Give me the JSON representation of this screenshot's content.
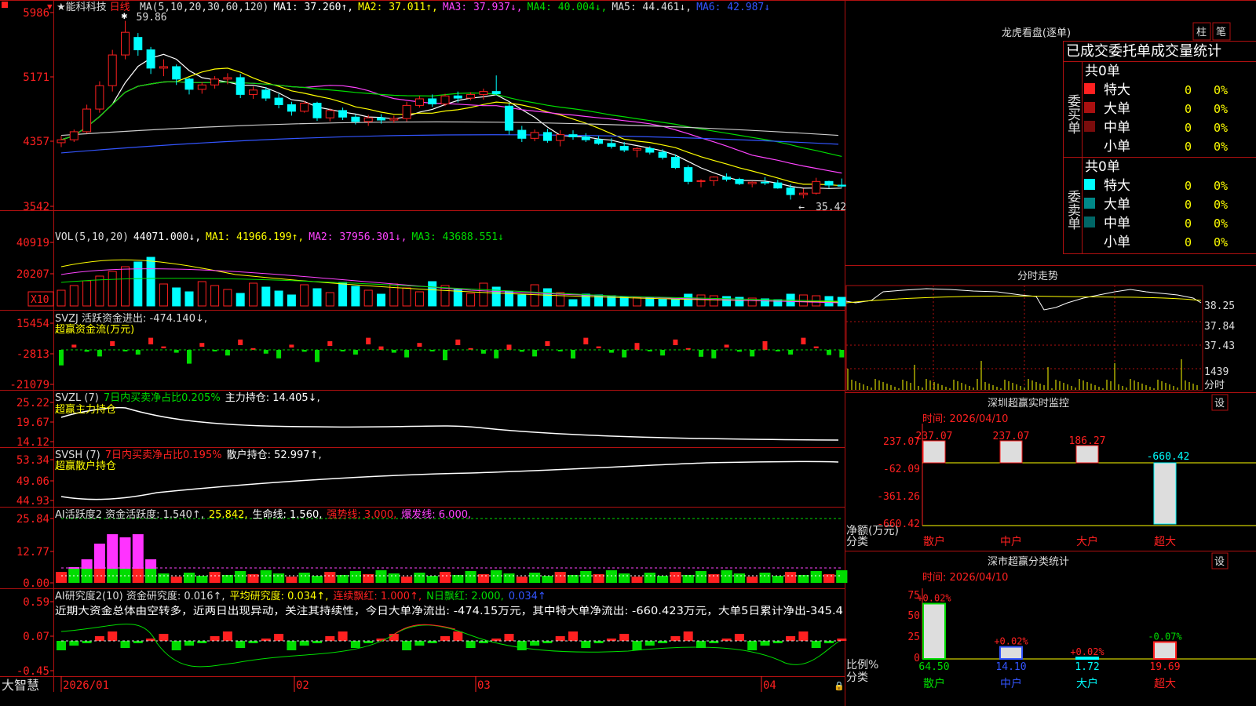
{
  "stock": {
    "star": "★",
    "name": "能科科技",
    "period": "日线"
  },
  "main_axis": [
    "5986",
    "5171",
    "4357",
    "3542"
  ],
  "ma_line": [
    {
      "text": "MA(5,10,20,30,60,120)",
      "color": "#dddddd"
    },
    {
      "text": "MA1: 37.260↑,",
      "color": "#ffffff"
    },
    {
      "text": "MA2: 37.011↑,",
      "color": "#ffff00"
    },
    {
      "text": "MA3: 37.937↓,",
      "color": "#ff44ff"
    },
    {
      "text": "MA4: 40.004↓,",
      "color": "#00dd00"
    },
    {
      "text": "MA5: 44.461↓,",
      "color": "#dddddd"
    },
    {
      "text": "MA6: 42.987↓",
      "color": "#3355ff"
    }
  ],
  "hi_label": "59.86",
  "lo_label": "35.42",
  "vol_header": [
    {
      "text": "VOL(5,10,20)",
      "color": "#dddddd"
    },
    {
      "text": "44071.000↓,",
      "color": "#ffffff"
    },
    {
      "text": "MA1: 41966.199↑,",
      "color": "#ffff00"
    },
    {
      "text": "MA2: 37956.301↓,",
      "color": "#ff44ff"
    },
    {
      "text": "MA3: 43688.551↓",
      "color": "#00dd00"
    }
  ],
  "vol_axis": [
    "40919",
    "20207"
  ],
  "vol_unit": "X10",
  "svzj": {
    "header": "SVZJ  活跃资金进出: -474.140↓,",
    "sub": "超赢资金流(万元)",
    "axis": [
      "15454",
      "-2813",
      "-21079"
    ]
  },
  "svzl": {
    "header_a": "SVZL (7)",
    "header_b": "7日内买卖净占比0.205%",
    "header_c": "主力持仓: 14.405↓,",
    "sub": "超赢主力持仓",
    "axis": [
      "25.22",
      "19.67",
      "14.12"
    ]
  },
  "svsh": {
    "header_a": "SVSH (7)",
    "header_b": "7日内买卖净占比0.195%",
    "header_c": "散户持仓: 52.997↑,",
    "sub": "超赢散户持仓",
    "axis": [
      "53.34",
      "49.06",
      "44.93"
    ]
  },
  "ai1": {
    "parts": [
      {
        "text": "AI活跃度2 资金活跃度: 1.540↑,",
        "color": "#dddddd"
      },
      {
        "text": "25.842,",
        "color": "#ffff00"
      },
      {
        "text": "生命线: 1.560,",
        "color": "#ffffff"
      },
      {
        "text": "强势线: 3.000,",
        "color": "#ff2020"
      },
      {
        "text": "爆发线: 6.000,",
        "color": "#ff44ff"
      }
    ],
    "axis": [
      "25.84",
      "12.77",
      "0.00"
    ]
  },
  "ai2": {
    "parts": [
      {
        "text": "AI研究度2(10) 资金研究度: 0.016↑,",
        "color": "#dddddd"
      },
      {
        "text": "平均研究度: 0.034↑,",
        "color": "#ffff00"
      },
      {
        "text": "连续飘红: 1.000↑,",
        "color": "#ff2020"
      },
      {
        "text": "N日飘红: 2.000,",
        "color": "#00dd00"
      },
      {
        "text": "0.034↑",
        "color": "#3355ff"
      }
    ],
    "note": "近期大资金总体由空转多，近两日出现异动，关注其持续性，今日大单净流出: -474.15万元，其中特大单净流出: -660.423万元，大单5日累计净出-345.4",
    "axis": [
      "0.59",
      "0.07",
      "-0.45"
    ]
  },
  "dates": [
    "2026/01",
    "02",
    "03",
    "04"
  ],
  "brand": "大智慧",
  "right": {
    "title": "龙虎看盘(逐单)",
    "btn1": "柱",
    "btn2": "笔",
    "subtitle": "已成交委托单成交量统计",
    "buy": {
      "side": "委买单",
      "count": "共0单",
      "rows": [
        {
          "label": "特大",
          "v": "0",
          "p": "0%"
        },
        {
          "label": "大单",
          "v": "0",
          "p": "0%"
        },
        {
          "label": "中单",
          "v": "0",
          "p": "0%"
        },
        {
          "label": "小单",
          "v": "0",
          "p": "0%"
        }
      ]
    },
    "sell": {
      "side": "委卖单",
      "count": "共0单",
      "rows": [
        {
          "label": "特大",
          "v": "0",
          "p": "0%"
        },
        {
          "label": "大单",
          "v": "0",
          "p": "0%"
        },
        {
          "label": "中单",
          "v": "0",
          "p": "0%"
        },
        {
          "label": "小单",
          "v": "0",
          "p": "0%"
        }
      ]
    },
    "fenshi": {
      "title": "分时走势",
      "axis": [
        "38.25",
        "37.84",
        "37.43"
      ],
      "vol": "1439",
      "unit": "分时"
    },
    "monitor": {
      "title": "深圳超赢实时监控",
      "btn": "设",
      "time": "时间: 2026/04/10",
      "axis": [
        "237.07",
        "-62.09",
        "-361.26",
        "-660.42"
      ],
      "ylabel": "净额(万元)",
      "xlabel": "分类",
      "cats": [
        "散户",
        "中户",
        "大户",
        "超大"
      ],
      "vals": [
        "237.07",
        "237.07",
        "186.27",
        "-660.42"
      ]
    },
    "classify": {
      "title": "深市超赢分类统计",
      "btn": "设",
      "time": "时间: 2026/04/10",
      "axis": [
        "75",
        "50",
        "25",
        "0"
      ],
      "ylabel": "比例%",
      "xlabel": "分类",
      "cats": [
        "散户",
        "中户",
        "大户",
        "超大"
      ],
      "tops": [
        "+0.02%",
        "+0.02%",
        "+0.02%",
        "-0.07%"
      ],
      "vals": [
        "64.50",
        "14.10",
        "1.72",
        "19.69"
      ]
    }
  },
  "chart_data": {
    "type": "candlestick",
    "title": "能科科技 日线",
    "x": [
      "2026/01",
      "02",
      "03",
      "04"
    ],
    "note": "approximate daily OHLC read from the chart",
    "candles": [
      [
        43.2,
        44.1,
        42.6,
        43.6
      ],
      [
        43.6,
        45.0,
        43.3,
        44.7
      ],
      [
        44.7,
        48.4,
        44.5,
        47.8
      ],
      [
        47.8,
        51.6,
        47.3,
        51.0
      ],
      [
        51.0,
        55.9,
        50.2,
        55.2
      ],
      [
        55.2,
        59.86,
        54.6,
        58.3
      ],
      [
        57.6,
        58.2,
        55.1,
        55.9
      ],
      [
        55.9,
        56.3,
        52.6,
        53.4
      ],
      [
        53.4,
        54.6,
        52.3,
        53.6
      ],
      [
        53.6,
        53.9,
        51.1,
        51.9
      ],
      [
        51.9,
        52.1,
        49.8,
        50.5
      ],
      [
        50.5,
        51.5,
        49.9,
        51.1
      ],
      [
        51.1,
        52.3,
        50.6,
        51.9
      ],
      [
        51.9,
        52.7,
        51.2,
        52.1
      ],
      [
        52.1,
        52.6,
        49.3,
        49.8
      ],
      [
        49.8,
        50.9,
        49.2,
        50.4
      ],
      [
        50.4,
        50.8,
        48.9,
        49.3
      ],
      [
        49.3,
        49.9,
        47.9,
        48.4
      ],
      [
        48.4,
        48.8,
        46.9,
        47.5
      ],
      [
        47.5,
        48.9,
        47.3,
        48.6
      ],
      [
        48.6,
        48.8,
        46.2,
        46.6
      ],
      [
        46.6,
        47.9,
        46.1,
        47.6
      ],
      [
        47.6,
        48.0,
        46.3,
        46.7
      ],
      [
        46.7,
        47.1,
        45.7,
        46.1
      ],
      [
        46.1,
        47.0,
        45.5,
        46.6
      ],
      [
        46.6,
        47.1,
        45.8,
        46.3
      ],
      [
        46.3,
        46.9,
        45.9,
        46.5
      ],
      [
        46.5,
        48.8,
        46.1,
        48.3
      ],
      [
        48.3,
        49.6,
        48.0,
        49.2
      ],
      [
        49.2,
        49.8,
        48.1,
        48.5
      ],
      [
        48.5,
        49.9,
        48.2,
        49.6
      ],
      [
        49.6,
        50.2,
        48.7,
        49.3
      ],
      [
        49.3,
        50.1,
        49.0,
        49.8
      ],
      [
        49.8,
        50.6,
        49.1,
        50.2
      ],
      [
        50.2,
        52.4,
        49.7,
        49.9
      ],
      [
        48.2,
        48.6,
        44.3,
        44.9
      ],
      [
        44.9,
        45.5,
        43.3,
        43.8
      ],
      [
        43.8,
        45.0,
        43.4,
        44.6
      ],
      [
        44.6,
        45.1,
        43.2,
        43.5
      ],
      [
        43.5,
        44.9,
        42.7,
        44.3
      ],
      [
        44.3,
        44.9,
        43.6,
        44.0
      ],
      [
        44.0,
        44.5,
        43.3,
        43.6
      ],
      [
        43.6,
        44.1,
        42.9,
        43.1
      ],
      [
        43.1,
        43.8,
        42.4,
        42.7
      ],
      [
        42.7,
        43.3,
        41.9,
        42.2
      ],
      [
        42.2,
        42.6,
        41.2,
        42.4
      ],
      [
        42.4,
        42.7,
        41.6,
        41.9
      ],
      [
        41.9,
        42.3,
        40.9,
        41.2
      ],
      [
        41.2,
        41.6,
        39.6,
        39.8
      ],
      [
        39.8,
        40.1,
        37.5,
        37.9
      ],
      [
        37.9,
        38.2,
        37.1,
        38.0
      ],
      [
        38.0,
        38.6,
        37.3,
        38.5
      ],
      [
        38.5,
        39.0,
        37.9,
        38.2
      ],
      [
        38.2,
        38.4,
        37.4,
        37.6
      ],
      [
        37.6,
        37.9,
        37.1,
        37.8
      ],
      [
        37.8,
        38.5,
        37.4,
        37.7
      ],
      [
        37.7,
        38.1,
        36.9,
        37.0
      ],
      [
        37.0,
        37.5,
        35.42,
        36.1
      ],
      [
        36.1,
        36.9,
        35.6,
        36.3
      ],
      [
        36.3,
        38.4,
        36.1,
        37.9
      ],
      [
        37.9,
        38.0,
        37.0,
        37.4
      ],
      [
        37.4,
        38.3,
        37.1,
        37.26
      ]
    ]
  }
}
